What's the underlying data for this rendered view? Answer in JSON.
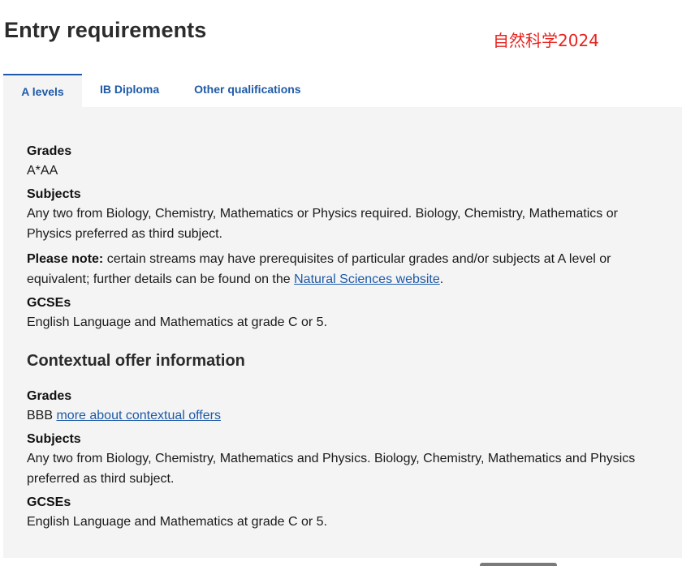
{
  "page": {
    "title": "Entry requirements",
    "annotation": "自然科学2024"
  },
  "tabs": [
    {
      "label": "A levels",
      "active": true
    },
    {
      "label": "IB Diploma",
      "active": false
    },
    {
      "label": "Other qualifications",
      "active": false
    }
  ],
  "requirements": {
    "grades_label": "Grades",
    "grades_value": "A*AA",
    "subjects_label": "Subjects",
    "subjects_value": "Any two from Biology, Chemistry, Mathematics or Physics required. Biology, Chemistry, Mathematics or Physics preferred as third subject.",
    "note_label": "Please note:",
    "note_text": " certain streams may have prerequisites of particular grades and/or subjects at A level or equivalent; further details can be found on the ",
    "note_link": "Natural Sciences website",
    "note_end": ".",
    "gcse_label": "GCSEs",
    "gcse_value": "English Language and Mathematics at grade C or 5."
  },
  "contextual": {
    "heading": "Contextual offer information",
    "grades_label": "Grades",
    "grades_value": "BBB",
    "grades_link": "more about contextual offers",
    "subjects_label": "Subjects",
    "subjects_value": "Any two from Biology, Chemistry, Mathematics and Physics. Biology, Chemistry, Mathematics and Physics preferred as third subject.",
    "gcse_label": "GCSEs",
    "gcse_value": "English Language and Mathematics at grade C or 5."
  },
  "colors": {
    "link": "#1e5aa8",
    "panel_bg": "#f4f4f4",
    "annotation": "#e8231f"
  }
}
